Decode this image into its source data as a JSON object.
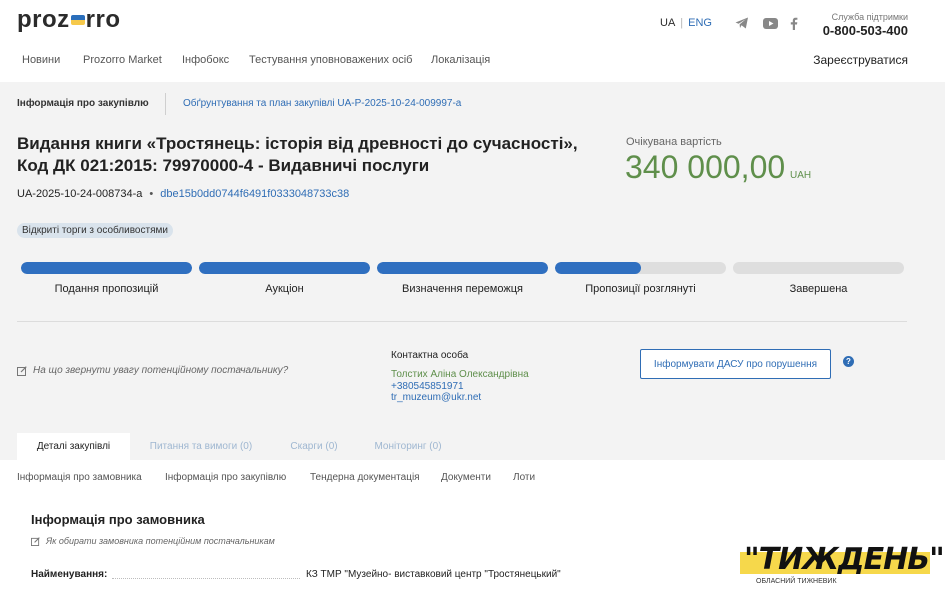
{
  "header": {
    "logo_left": "proz",
    "logo_right": "rro",
    "lang_ua": "UA",
    "lang_sep": "|",
    "lang_eng": "ENG",
    "support_label": "Служба підтримки",
    "support_phone": "0-800-503-400",
    "register": "Зареєструватися",
    "nav": [
      "Новини",
      "Prozorro Market",
      "Інфобокс",
      "Тестування уповноважених осіб",
      "Локалізація"
    ]
  },
  "breadcrumb": {
    "item1": "Інформація про закупівлю",
    "item2": "Обґрунтування та план закупівлі UA-P-2025-10-24-009997-a"
  },
  "tender": {
    "title": "Видання книги «Тростянець: історія від древності до сучасності», Код ДК 021:2015: 79970000-4 - Видавничі послуги",
    "id": "UA-2025-10-24-008734-a",
    "dot": "•",
    "hash": "dbe15b0dd0744f6491f0333048733c38",
    "badge": "Відкриті торги з особливостями",
    "cost_label": "Очікувана вартість",
    "cost": "340 000,00",
    "currency": "UAH"
  },
  "stages": [
    {
      "label": "Подання пропозицій",
      "progress": 1.0
    },
    {
      "label": "Аукціон",
      "progress": 1.0
    },
    {
      "label": "Визначення переможця",
      "progress": 1.0
    },
    {
      "label": "Пропозиції розглянуті",
      "progress": 0.5
    },
    {
      "label": "Завершена",
      "progress": 0.0
    }
  ],
  "contact": {
    "hint": "На що звернути увагу потенційному постачальнику?",
    "label": "Контактна особа",
    "name": "Толстих Аліна Олександрівна",
    "phone": "+380545851971",
    "email": "tr_muzeum@ukr.net",
    "dasu_button": "Інформувати ДАСУ про порушення",
    "help": "?"
  },
  "tabs": [
    "Деталі закупівлі",
    "Питання та вимоги (0)",
    "Скарги (0)",
    "Моніторинг (0)"
  ],
  "subnav": [
    "Інформація про замовника",
    "Інформація про закупівлю",
    "Тендерна документація",
    "Документи",
    "Лоти"
  ],
  "customer": {
    "title": "Інформація про замовника",
    "hint": "Як обирати замовника потенційним постачальникам",
    "name_label": "Найменування:",
    "name_value": "КЗ ТМР \"Музейно- виставковий центр \"Тростянецький\""
  },
  "watermark": {
    "text": "\"ТИЖДЕНЬ\"",
    "sub": "ОБЛАСНИЙ ТИЖНЕВИК"
  },
  "colors": {
    "accent": "#2f6db5",
    "green": "#5f8f4b",
    "progress": "#2f6fc0",
    "watermark_yellow": "#f6d84b"
  }
}
